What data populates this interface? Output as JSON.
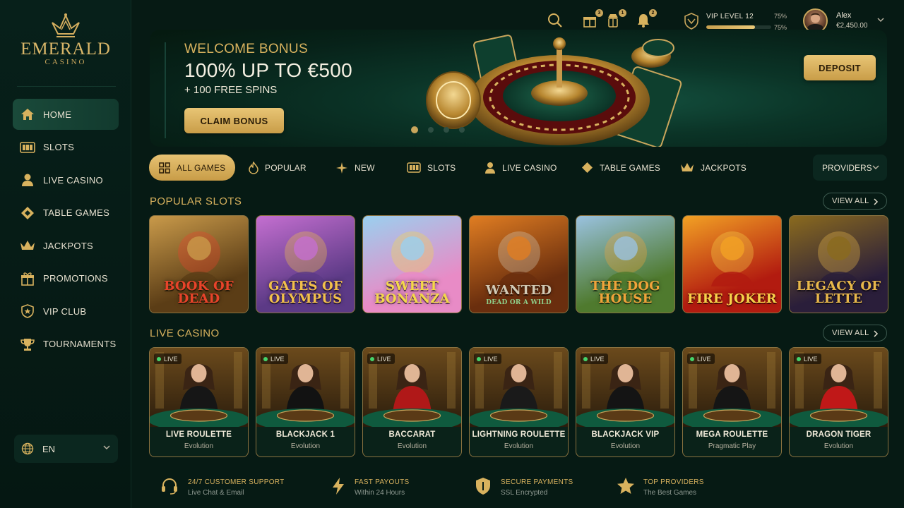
{
  "brand": {
    "name": "EMERALD",
    "sub": "CASINO"
  },
  "sidebar": {
    "items": [
      {
        "label": "HOME",
        "icon": "home-icon",
        "active": true
      },
      {
        "label": "SLOTS",
        "icon": "slot-machine-icon"
      },
      {
        "label": "LIVE CASINO",
        "icon": "dealer-icon"
      },
      {
        "label": "TABLE GAMES",
        "icon": "diamond-chip-icon"
      },
      {
        "label": "JACKPOTS",
        "icon": "crown-icon"
      },
      {
        "label": "PROMOTIONS",
        "icon": "gift-icon"
      },
      {
        "label": "VIP CLUB",
        "icon": "shield-icon"
      },
      {
        "label": "TOURNAMENTS",
        "icon": "trophy-icon"
      }
    ],
    "language": "EN"
  },
  "topbar": {
    "badges": {
      "gifts": "3",
      "rewards": "1",
      "notifications": "2"
    },
    "vip": {
      "label": "VIP LEVEL 12",
      "pct_top": "75%",
      "pct_bottom": "75%",
      "progress": 0.75
    },
    "user": {
      "name": "Alex",
      "balance": "€2,450.00"
    }
  },
  "hero": {
    "eyebrow": "WELCOME BONUS",
    "headline": "100% UP TO €500",
    "subline": "+ 100 FREE SPINS",
    "cta": "CLAIM BONUS",
    "deposit": "DEPOSIT",
    "slides": 4,
    "active_slide": 0
  },
  "tabs": [
    {
      "label": "ALL GAMES",
      "icon": "grid-icon",
      "active": true
    },
    {
      "label": "POPULAR",
      "icon": "flame-icon"
    },
    {
      "label": "NEW",
      "icon": "sparkle-icon"
    },
    {
      "label": "SLOTS",
      "icon": "slot-machine-icon"
    },
    {
      "label": "LIVE CASINO",
      "icon": "dealer-icon"
    },
    {
      "label": "TABLE GAMES",
      "icon": "diamond-chip-icon"
    },
    {
      "label": "JACKPOTS",
      "icon": "crown-icon"
    }
  ],
  "providers_label": "PROVIDERS",
  "popular_slots": {
    "title": "POPULAR SLOTS",
    "view_all": "VIEW ALL",
    "games": [
      {
        "title": "BOOK OF DEAD",
        "bg": "#5b3d16",
        "bg2": "#c99a4a",
        "fg": "#e8432a"
      },
      {
        "title": "GATES OF OLYMPUS",
        "bg": "#5c3a86",
        "bg2": "#c46fd0",
        "fg": "#f2c04a"
      },
      {
        "title": "SWEET BONANZA",
        "bg": "#e88bc6",
        "bg2": "#9ad0ef",
        "fg": "#f4d84a"
      },
      {
        "title": "WANTED",
        "sub": "DEAD OR A WILD",
        "bg": "#6a2e0e",
        "bg2": "#e07d22",
        "fg": "#d2c9b4"
      },
      {
        "title": "THE DOG HOUSE",
        "bg": "#4f7a2e",
        "bg2": "#9ac2e0",
        "fg": "#f0a33a"
      },
      {
        "title": "FIRE JOKER",
        "bg": "#b21b10",
        "bg2": "#f2a124",
        "fg": "#f6d24a"
      },
      {
        "title": "LEGACY OF LETTE",
        "bg": "#2a1e3a",
        "bg2": "#8a6a1e",
        "fg": "#e8b84a"
      }
    ]
  },
  "live_casino": {
    "title": "LIVE CASINO",
    "view_all": "VIEW ALL",
    "live_label": "LIVE",
    "games": [
      {
        "name": "LIVE ROULETTE",
        "provider": "Evolution",
        "dress": "#161616"
      },
      {
        "name": "BLACKJACK 1",
        "provider": "Evolution",
        "dress": "#121212"
      },
      {
        "name": "BACCARAT",
        "provider": "Evolution",
        "dress": "#b01818"
      },
      {
        "name": "LIGHTNING ROULETTE",
        "provider": "Evolution",
        "dress": "#1a1a1a"
      },
      {
        "name": "BLACKJACK VIP",
        "provider": "Evolution",
        "dress": "#141414"
      },
      {
        "name": "MEGA ROULETTE",
        "provider": "Pragmatic Play",
        "dress": "#151515"
      },
      {
        "name": "DRAGON TIGER",
        "provider": "Evolution",
        "dress": "#c01818"
      }
    ]
  },
  "features": [
    {
      "title": "24/7 CUSTOMER SUPPORT",
      "sub": "Live Chat & Email",
      "icon": "headset-icon"
    },
    {
      "title": "FAST PAYOUTS",
      "sub": "Within 24 Hours",
      "icon": "lightning-icon"
    },
    {
      "title": "SECURE PAYMENTS",
      "sub": "SSL Encrypted",
      "icon": "secure-shield-icon"
    },
    {
      "title": "TOP PROVIDERS",
      "sub": "The Best Games",
      "icon": "star-icon"
    }
  ],
  "colors": {
    "accent": "#d8b25e",
    "background": "#061a14",
    "live": "#45d36a"
  }
}
